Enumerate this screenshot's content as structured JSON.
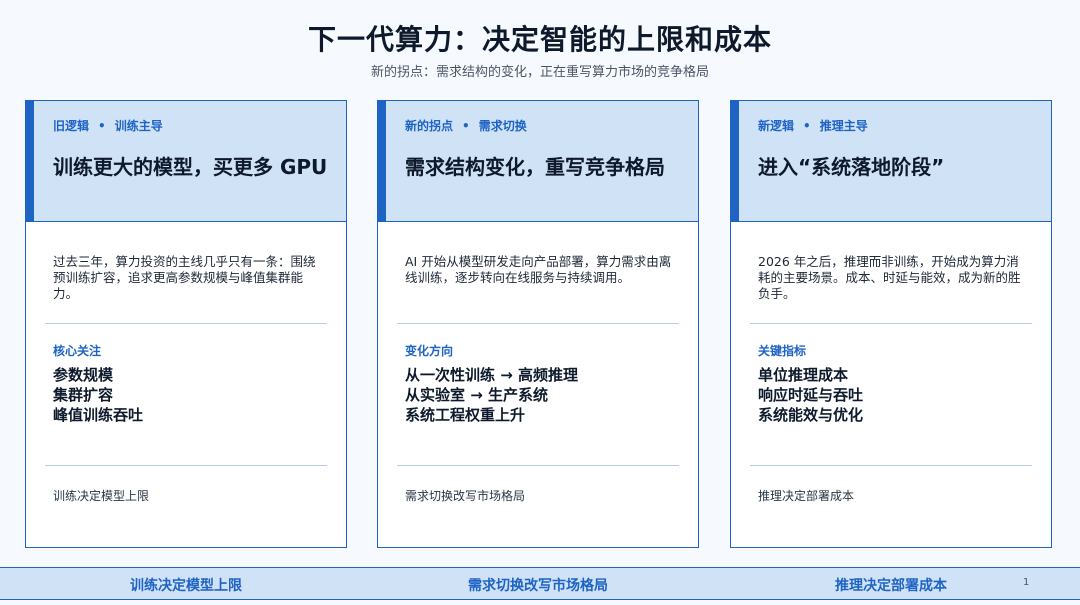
{
  "header": {
    "title": "下一代算力：决定智能的上限和成本",
    "subtitle": "新的拐点：需求结构的变化，正在重写算力市场的竞争格局"
  },
  "cards": [
    {
      "tag_a": "旧逻辑",
      "tag_sep": "•",
      "tag_b": "训练主导",
      "title": "训练更大的模型，买更多 GPU",
      "desc": "过去三年，算力投资的主线几乎只有一条：围绕预训练扩容，追求更高参数规模与峰值集群能力。",
      "section_label": "核心关注",
      "points": [
        "参数规模",
        "集群扩容",
        "峰值训练吞吐"
      ],
      "footer": "训练决定模型上限"
    },
    {
      "tag_a": "新的拐点",
      "tag_sep": "•",
      "tag_b": "需求切换",
      "title": "需求结构变化，重写竞争格局",
      "desc": "AI 开始从模型研发走向产品部署，算力需求由离线训练，逐步转向在线服务与持续调用。",
      "section_label": "变化方向",
      "points": [
        "从一次性训练 → 高频推理",
        "从实验室 → 生产系统",
        "系统工程权重上升"
      ],
      "footer": "需求切换改写市场格局"
    },
    {
      "tag_a": "新逻辑",
      "tag_sep": "•",
      "tag_b": "推理主导",
      "title": "进入“系统落地阶段”",
      "desc": "2026 年之后，推理而非训练，开始成为算力消耗的主要场景。成本、时延与能效，成为新的胜负手。",
      "section_label": "关键指标",
      "points": [
        "单位推理成本",
        "响应时延与吞吐",
        "系统能效与优化"
      ],
      "footer": "推理决定部署成本"
    }
  ],
  "bottom_bar": {
    "items": [
      "训练决定模型上限",
      "需求切换改写市场格局",
      "推理决定部署成本"
    ],
    "page_number": "1"
  },
  "colors": {
    "accent": "#1f64c4",
    "card_header_bg": "#cfe2f6",
    "background": "#f6f9fd",
    "title_text": "#0e1a2b"
  }
}
